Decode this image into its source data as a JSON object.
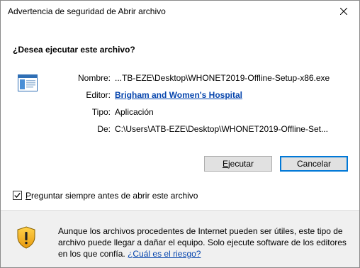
{
  "window": {
    "title": "Advertencia de seguridad de Abrir archivo",
    "close_icon": "close-icon"
  },
  "question": "¿Desea ejecutar este archivo?",
  "file_icon": "executable-file-icon",
  "details": {
    "name_label": "Nombre:",
    "name_value": "...TB-EZE\\Desktop\\WHONET2019-Offline-Setup-x86.exe",
    "publisher_label": "Editor:",
    "publisher_value": "Brigham and Women's Hospital",
    "type_label": "Tipo:",
    "type_value": "Aplicación",
    "from_label": "De:",
    "from_value": "C:\\Users\\ATB-EZE\\Desktop\\WHONET2019-Offline-Set..."
  },
  "buttons": {
    "run_accel": "E",
    "run_rest": "jecutar",
    "cancel_label": "Cancelar"
  },
  "checkbox": {
    "checked": true,
    "accel": "P",
    "rest": "reguntar siempre antes de abrir este archivo"
  },
  "warning": {
    "icon": "shield-warning-icon",
    "text": "Aunque los archivos procedentes de Internet pueden ser útiles, este tipo de archivo puede llegar a dañar el equipo. Solo ejecute software de los editores en los que confía.",
    "link": "¿Cuál es el riesgo?"
  },
  "colors": {
    "link": "#0645ad",
    "default_button_border": "#0078d7",
    "footer_background": "#f0f0f0"
  }
}
